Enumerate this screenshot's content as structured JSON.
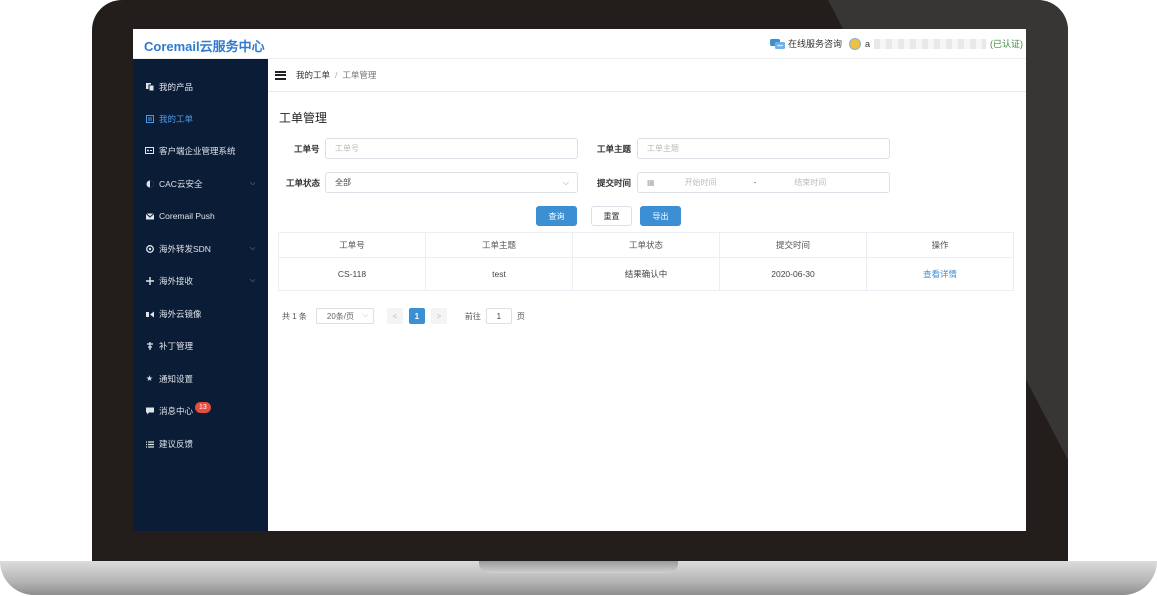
{
  "colors": {
    "brand": "#2e7bd0",
    "sidebar_bg": "#0b1d36",
    "primary": "#3d8fd4",
    "badge": "#e84c3d"
  },
  "header": {
    "brand": "Coremail云服务中心",
    "service_link": "在线服务咨询",
    "user_prefix": "a",
    "user_suffix": "(已认证)"
  },
  "sidebar": {
    "items": [
      {
        "label": "我的产品",
        "icon": "product-icon"
      },
      {
        "label": "我的工单",
        "icon": "ticket-icon",
        "active": true
      },
      {
        "label": "客户端企业管理系统",
        "icon": "client-icon"
      },
      {
        "label": "CAC云安全",
        "icon": "cloud-security-icon",
        "expandable": true
      },
      {
        "label": "Coremail Push",
        "icon": "mail-icon"
      },
      {
        "label": "海外转发SDN",
        "icon": "forward-icon",
        "expandable": true
      },
      {
        "label": "海外接收",
        "icon": "receive-icon",
        "expandable": true
      },
      {
        "label": "海外云镜像",
        "icon": "mirror-icon"
      },
      {
        "label": "补丁管理",
        "icon": "patch-icon"
      },
      {
        "label": "通知设置",
        "icon": "star-icon"
      },
      {
        "label": "消息中心",
        "icon": "message-icon",
        "badge": "13"
      },
      {
        "label": "建议反馈",
        "icon": "list-icon"
      }
    ]
  },
  "breadcrumb": {
    "parent": "我的工单",
    "separator": "/",
    "current": "工单管理"
  },
  "page_title": "工单管理",
  "form": {
    "ticket_no_label": "工单号",
    "ticket_no_placeholder": "工单号",
    "subject_label": "工单主题",
    "subject_placeholder": "工单主题",
    "status_label": "工单状态",
    "status_value": "全部",
    "time_label": "提交时间",
    "start_placeholder": "开始时间",
    "range_separator": "-",
    "end_placeholder": "结束时间"
  },
  "buttons": {
    "query": "查询",
    "reset": "重置",
    "export": "导出"
  },
  "table": {
    "headers": [
      "工单号",
      "工单主题",
      "工单状态",
      "提交时间",
      "操作"
    ],
    "rows": [
      [
        "CS-118",
        "test",
        "结果确认中",
        "2020-06-30",
        "查看详情"
      ]
    ]
  },
  "pagination": {
    "total": "共 1 条",
    "page_size": "20条/页",
    "prev": "<",
    "current_page": "1",
    "next": ">",
    "goto_prefix": "前往",
    "goto_value": "1",
    "goto_suffix": "页"
  }
}
